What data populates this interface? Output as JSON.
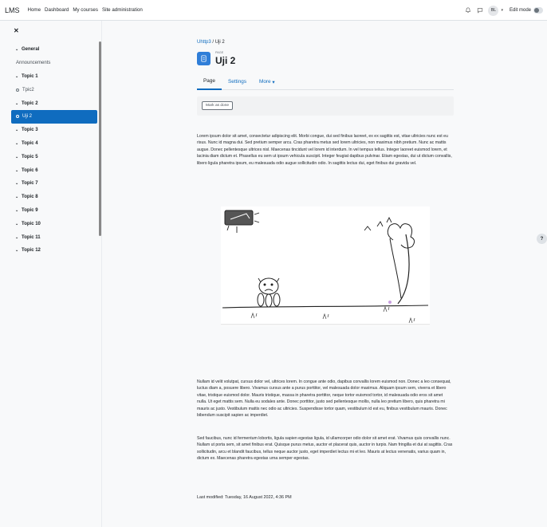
{
  "topbar": {
    "brand": "LMS",
    "nav": [
      "Home",
      "Dashboard",
      "My courses",
      "Site administration"
    ],
    "avatar_initials": "BL",
    "edit_mode_label": "Edit mode"
  },
  "drawer": {
    "close_icon": "close-icon",
    "items": [
      {
        "label": "General",
        "type": "section"
      },
      {
        "label": "Announcements",
        "type": "sub",
        "icon": "none"
      },
      {
        "label": "Topic 1",
        "type": "section"
      },
      {
        "label": "Tpic2",
        "type": "sub",
        "icon": "circle"
      },
      {
        "label": "Topic 2",
        "type": "section"
      },
      {
        "label": "Uji 2",
        "type": "sub",
        "icon": "circle",
        "active": true
      },
      {
        "label": "Topic 3",
        "type": "section"
      },
      {
        "label": "Topic 4",
        "type": "section"
      },
      {
        "label": "Topic 5",
        "type": "section"
      },
      {
        "label": "Topic 6",
        "type": "section"
      },
      {
        "label": "Topic 7",
        "type": "section"
      },
      {
        "label": "Topic 8",
        "type": "section"
      },
      {
        "label": "Topic 9",
        "type": "section"
      },
      {
        "label": "Topic 10",
        "type": "section"
      },
      {
        "label": "Topic 11",
        "type": "section"
      },
      {
        "label": "Topic 12",
        "type": "section"
      }
    ]
  },
  "main": {
    "breadcrumb_link": "Uhttp3",
    "breadcrumb_sep": "/",
    "breadcrumb_current": "Uji 2",
    "page_tag": "PAGE",
    "title": "Uji 2",
    "tabs": [
      "Page",
      "Settings",
      "More"
    ],
    "mark_done": "Mark as done",
    "para1": "Lorem ipsum dolor sit amet, consectetur adipiscing elit. Morbi congue, dui sed finibus laoreet, ex ex sagittis est, vitae ultricies nunc est eu risus. Nunc id magna dui. Sed pretium semper arcu. Cras pharetra metus sed lorem ultricies, non maximus nibh pretium. Nunc ac mattis augue. Donec pellentesque ultrices nisl. Maecenas tincidunt vel lorem id interdum. In vel tempus tellus. Integer laoreet euismod lorem, et lacinia diam dictum et. Phasellus eu sem ut ipsum vehicula suscipit. Integer feugiat dapibus pulvinar. Etiam egestas, dui ut dictum convallis, libero ligula pharetra ipsum, eu malesuada odio augue sollicitudin odio. In sagittis lectus dui, eget finibus dui gravida vel.",
    "para2": "Nullam id velit volutpat, cursus dolor vel, ultrices lorem. In congue ante odio, dapibus convallis lorem euismod non. Donec a leo consequat, luctus diam a, posuere libero. Vivamus cursus ante a purus porttitor, vel malesuada dolor maximus. Aliquam ipsum sem, viverra et libero vitae, tristique euismod dolor. Mauris tristique, massa in pharetra porttitor, neque tortor euismod tortor, id malesuada odio eros sit amet nulla. Ut eget mattis sem. Nulla eu sodales ante. Donec porttitor, justo sed pellentesque mollis, nulla leo pretium libero, quis pharetra mi mauris ac justo. Vestibulum mattis nec odio ac ultricies. Suspendisse tortor quam, vestibulum id est eu, finibus vestibulum mauris. Donec bibendum suscipit sapien ac imperdiet.",
    "para3": "Sed faucibus, nunc id fermentum lobortis, ligula sapien egestas ligula, id ullamcorper odio dolor sit amet erat. Vivamus quis convallis nunc. Nullam ut porta sem, sit amet finibus erat. Quisque purus metus, auctor et placerat quis, auctor in turpis. Nam fringilla et dui at sagittis. Cras sollicitudin, arcu et blandit faucibus, tellus neque auctor justo, eget imperdiet lectus mi et leo. Mauris at lectus venenatis, varius quam in, dictum ex. Maecenas pharetra egestas urna semper egestas.",
    "last_modified": "Last modified: Tuesday, 16 August 2022, 4:36 PM"
  },
  "help_label": "?",
  "colors": {
    "accent": "#0f6cbf",
    "icon_blue": "#2f7ed8"
  }
}
